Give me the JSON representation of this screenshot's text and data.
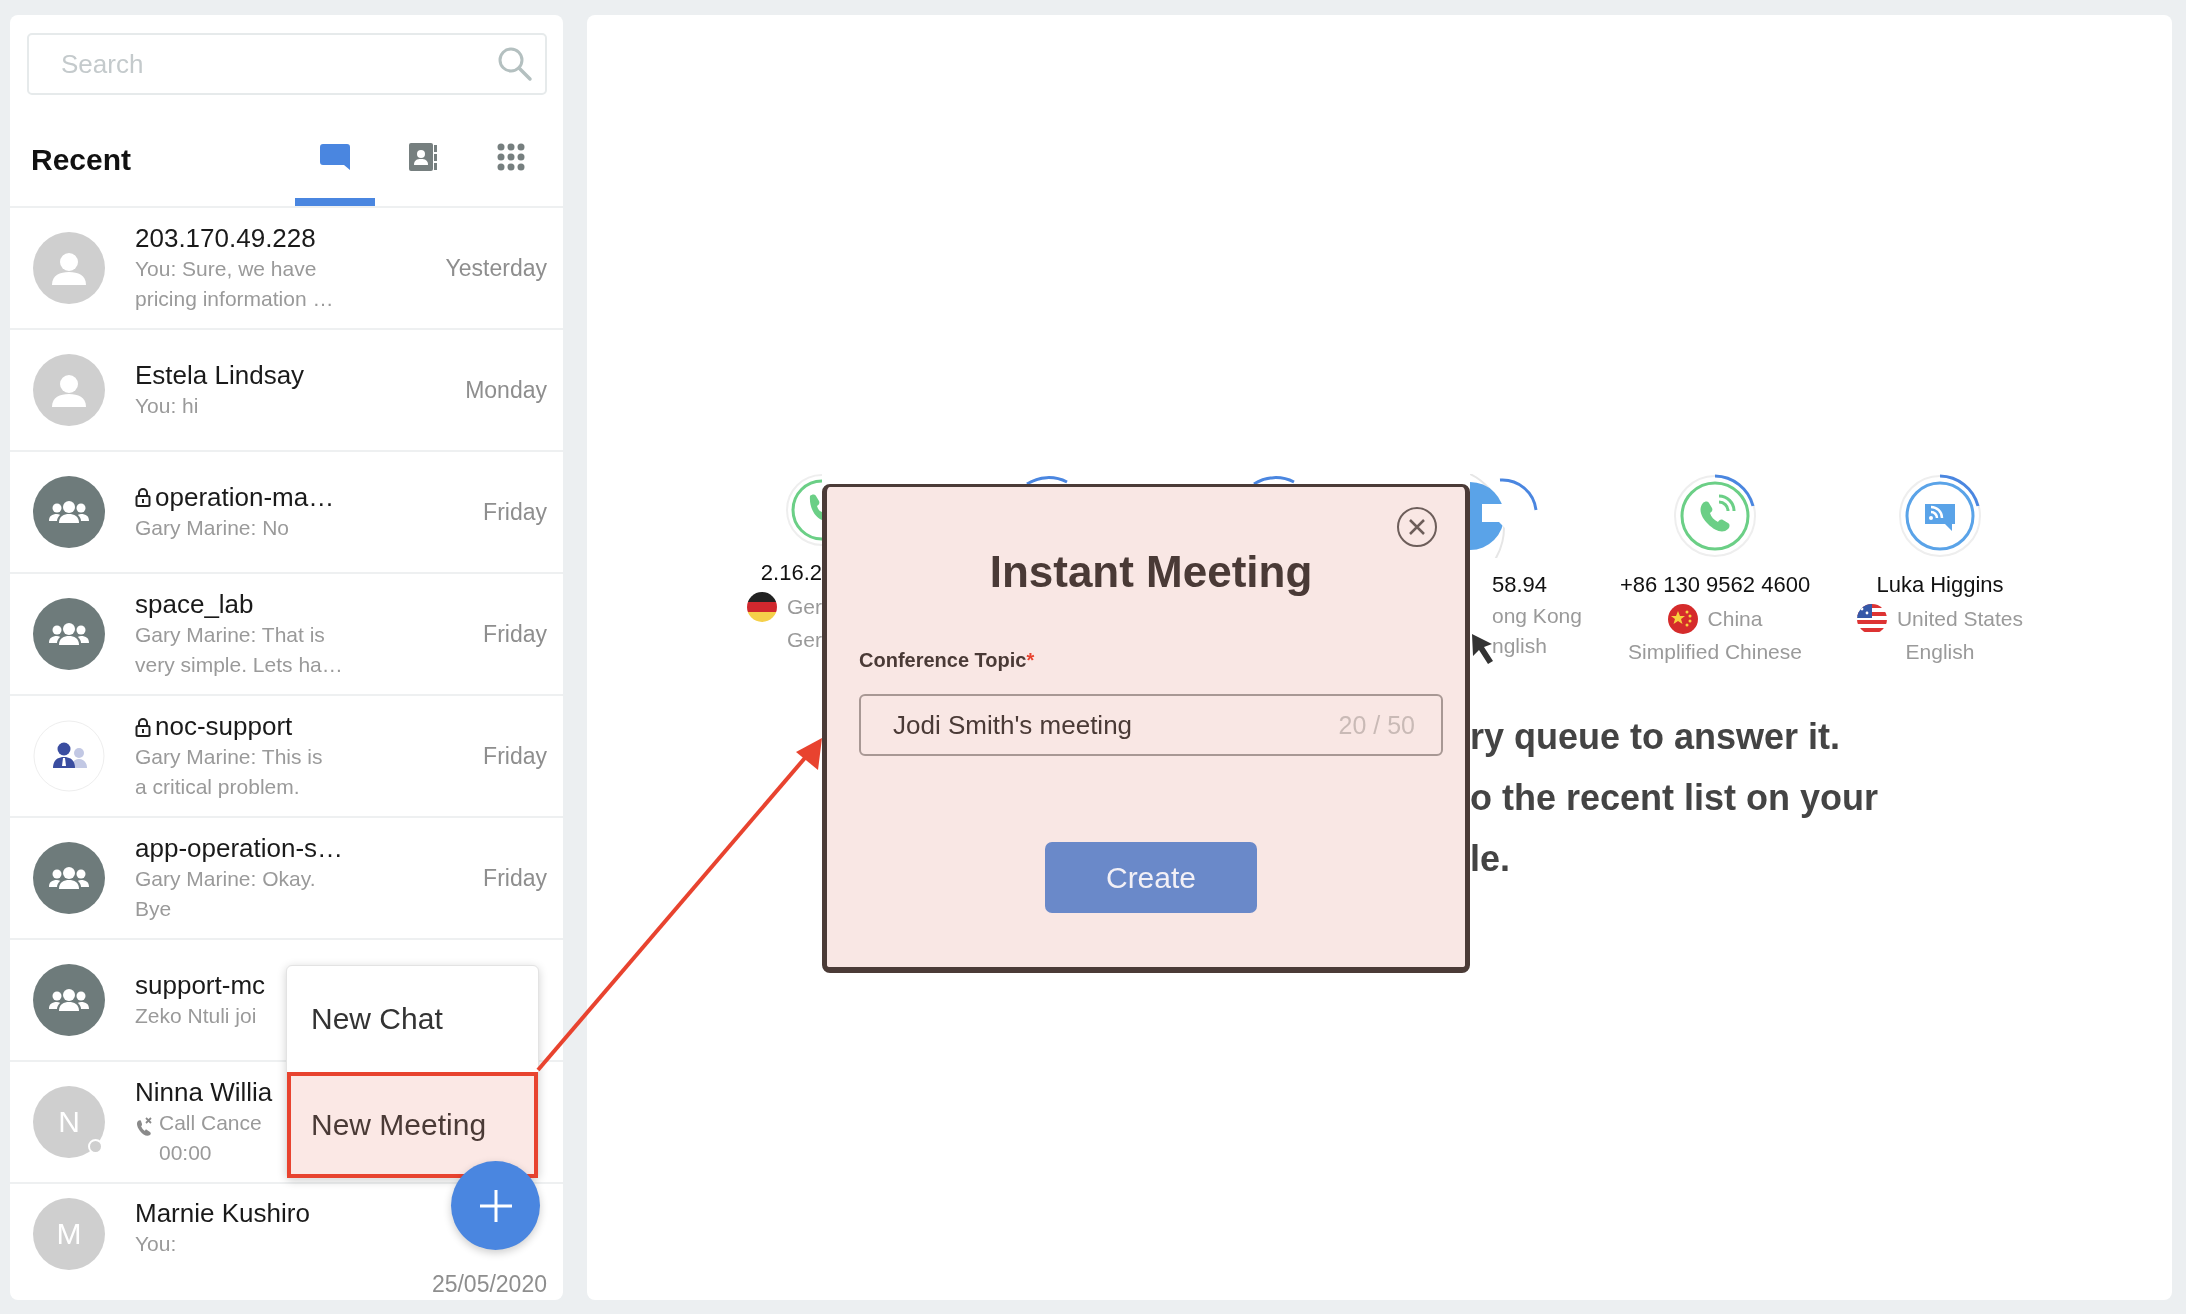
{
  "sidebar": {
    "search": {
      "placeholder": "Search"
    },
    "title": "Recent",
    "tabs": [
      {
        "kind": "chat",
        "selected": true
      },
      {
        "kind": "contacts",
        "selected": false
      },
      {
        "kind": "dialpad",
        "selected": false
      }
    ],
    "conversations": [
      {
        "kind": "person",
        "name": "203.170.49.228",
        "locked": false,
        "preview": [
          "You: Sure, we have",
          "pricing information …"
        ],
        "time": "Yesterday"
      },
      {
        "kind": "person",
        "name": "Estela Lindsay",
        "locked": false,
        "preview": [
          "You: hi"
        ],
        "time": "Monday"
      },
      {
        "kind": "group",
        "name": "operation-ma…",
        "locked": true,
        "preview": [
          "Gary Marine: No"
        ],
        "time": "Friday"
      },
      {
        "kind": "group",
        "name": "space_lab",
        "locked": false,
        "preview": [
          "Gary Marine: That is",
          "very simple. Lets ha…"
        ],
        "time": "Friday"
      },
      {
        "kind": "team",
        "name": "noc-support",
        "locked": true,
        "preview": [
          "Gary Marine: This is",
          "a critical problem."
        ],
        "time": "Friday"
      },
      {
        "kind": "group",
        "name": "app-operation-s…",
        "locked": false,
        "preview": [
          "Gary Marine: Okay.",
          "Bye"
        ],
        "time": "Friday"
      },
      {
        "kind": "group",
        "name": "support-mc",
        "locked": false,
        "preview": [
          "Zeko Ntuli joi"
        ]
      },
      {
        "kind": "call",
        "initial": "N",
        "status_dot": true,
        "name": "Ninna Willia",
        "locked": false,
        "preview": [
          "Call Cance",
          "00:00"
        ]
      },
      {
        "kind": "contact",
        "initial": "M",
        "name": "Marnie Kushiro",
        "locked": false,
        "preview": [
          "You:"
        ],
        "time": "25/05/2020"
      }
    ],
    "new_menu": {
      "items": [
        {
          "label": "New Chat",
          "selected": false
        },
        {
          "label": "New Meeting",
          "selected": true
        }
      ]
    }
  },
  "queue": {
    "left_item": {
      "kind": "call",
      "number": "2.16.2",
      "flag": {
        "kind": "de"
      },
      "country": "Ger",
      "language": "Ger"
    },
    "right_item": {
      "kind": "chat",
      "number": "58.94",
      "country": "ong Kong",
      "language": "nglish"
    },
    "items": [
      {
        "kind": "call",
        "number": "+86 130 9562 4600",
        "flag": {
          "kind": "cn"
        },
        "country": "China",
        "language": "Simplified Chinese"
      },
      {
        "kind": "chat",
        "number": "Luka Higgins",
        "flag": {
          "kind": "us"
        },
        "country": "United States",
        "language": "English"
      }
    ]
  },
  "message_lines": [
    "ry queue to answer it.",
    "o the recent list on your",
    "le."
  ],
  "modal": {
    "title": "Instant Meeting",
    "field_label": "Conference Topic",
    "required_mark": "*",
    "value": "Jodi Smith's meeting",
    "counter": "20 / 50",
    "button": "Create"
  }
}
